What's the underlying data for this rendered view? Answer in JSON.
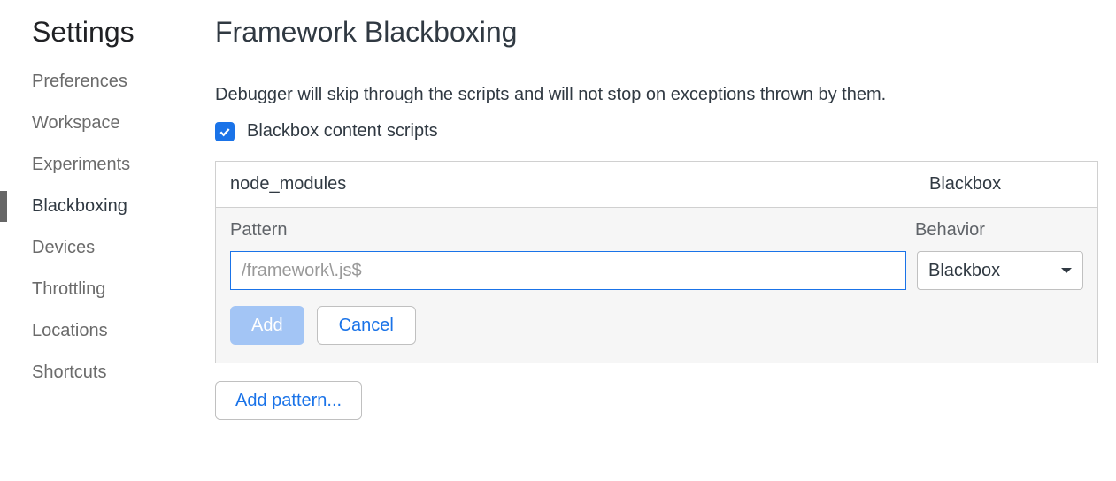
{
  "sidebar": {
    "title": "Settings",
    "items": [
      {
        "label": "Preferences",
        "active": false
      },
      {
        "label": "Workspace",
        "active": false
      },
      {
        "label": "Experiments",
        "active": false
      },
      {
        "label": "Blackboxing",
        "active": true
      },
      {
        "label": "Devices",
        "active": false
      },
      {
        "label": "Throttling",
        "active": false
      },
      {
        "label": "Locations",
        "active": false
      },
      {
        "label": "Shortcuts",
        "active": false
      }
    ]
  },
  "main": {
    "title": "Framework Blackboxing",
    "description": "Debugger will skip through the scripts and will not stop on exceptions thrown by them.",
    "checkbox": {
      "checked": true,
      "label": "Blackbox content scripts"
    },
    "patterns": {
      "rows": [
        {
          "pattern": "node_modules",
          "behavior": "Blackbox"
        }
      ],
      "edit": {
        "header_pattern": "Pattern",
        "header_behavior": "Behavior",
        "input_placeholder": "/framework\\.js$",
        "input_value": "",
        "behavior_selected": "Blackbox",
        "add_label": "Add",
        "cancel_label": "Cancel"
      }
    },
    "add_pattern_label": "Add pattern..."
  }
}
